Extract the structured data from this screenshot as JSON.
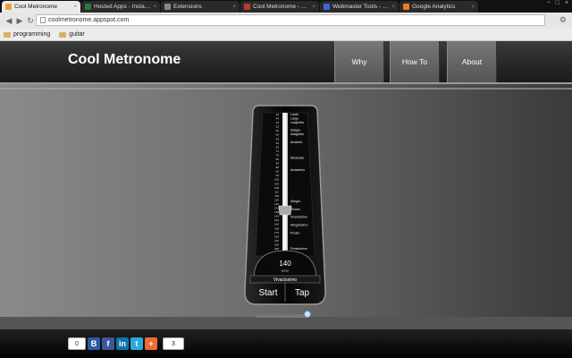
{
  "browser": {
    "tabs": [
      {
        "title": "Cool Metronome",
        "active": true,
        "favicon_color": "#e8a030"
      },
      {
        "title": "Hosted Apps - Installable",
        "active": false,
        "favicon_color": "#2a7a3a"
      },
      {
        "title": "Extensions",
        "active": false,
        "favicon_color": "#888888"
      },
      {
        "title": "Cool Metronome - Edit Ite",
        "active": false,
        "favicon_color": "#c0392b"
      },
      {
        "title": "Webmaster Tools - Dashb",
        "active": false,
        "favicon_color": "#3a6ad4"
      },
      {
        "title": "Google Analytics",
        "active": false,
        "favicon_color": "#e67e22"
      }
    ],
    "window_controls": [
      "−",
      "□",
      "×"
    ],
    "url": "coolmetronome.appspot.com",
    "bookmarks": [
      {
        "label": "programming"
      },
      {
        "label": "guitar"
      }
    ]
  },
  "site": {
    "title": "Cool Metronome",
    "nav": [
      {
        "label": "Why"
      },
      {
        "label": "How To"
      },
      {
        "label": "About"
      }
    ]
  },
  "metronome": {
    "bpm": "140",
    "bpm_unit": "BPM",
    "tempo_name": "Vivacissimo",
    "start_label": "Start",
    "tap_label": "Tap",
    "scale_numbers": [
      "40",
      "44",
      "48",
      "52",
      "56",
      "60",
      "63",
      "66",
      "69",
      "72",
      "76",
      "80",
      "84",
      "88",
      "92",
      "96",
      "100",
      "104",
      "108",
      "112",
      "116",
      "120",
      "126",
      "132",
      "138",
      "144",
      "152",
      "160",
      "168",
      "176",
      "184",
      "192",
      "200",
      "208"
    ],
    "tempo_markings": [
      "Lento",
      "Largo",
      "Larghetto",
      "Adagio",
      "Adagietto",
      "Andante",
      "Moderato",
      "Andantino",
      "Allegro",
      "Vivace",
      "Vivacissimo",
      "Allegrissimo",
      "Presto",
      "Prestissimo"
    ],
    "tempo_slider_fraction": 0.9
  },
  "share": {
    "count_left": "0",
    "icons": [
      "blogger-icon",
      "facebook-icon",
      "linkedin-icon",
      "twitter-icon",
      "addthis-icon"
    ],
    "count_right": "3",
    "colors": {
      "blogger": "#2b5aa5",
      "facebook": "#3b5998",
      "linkedin": "#0e76a8",
      "twitter": "#2aa9e0",
      "addthis": "#f06a35"
    }
  }
}
